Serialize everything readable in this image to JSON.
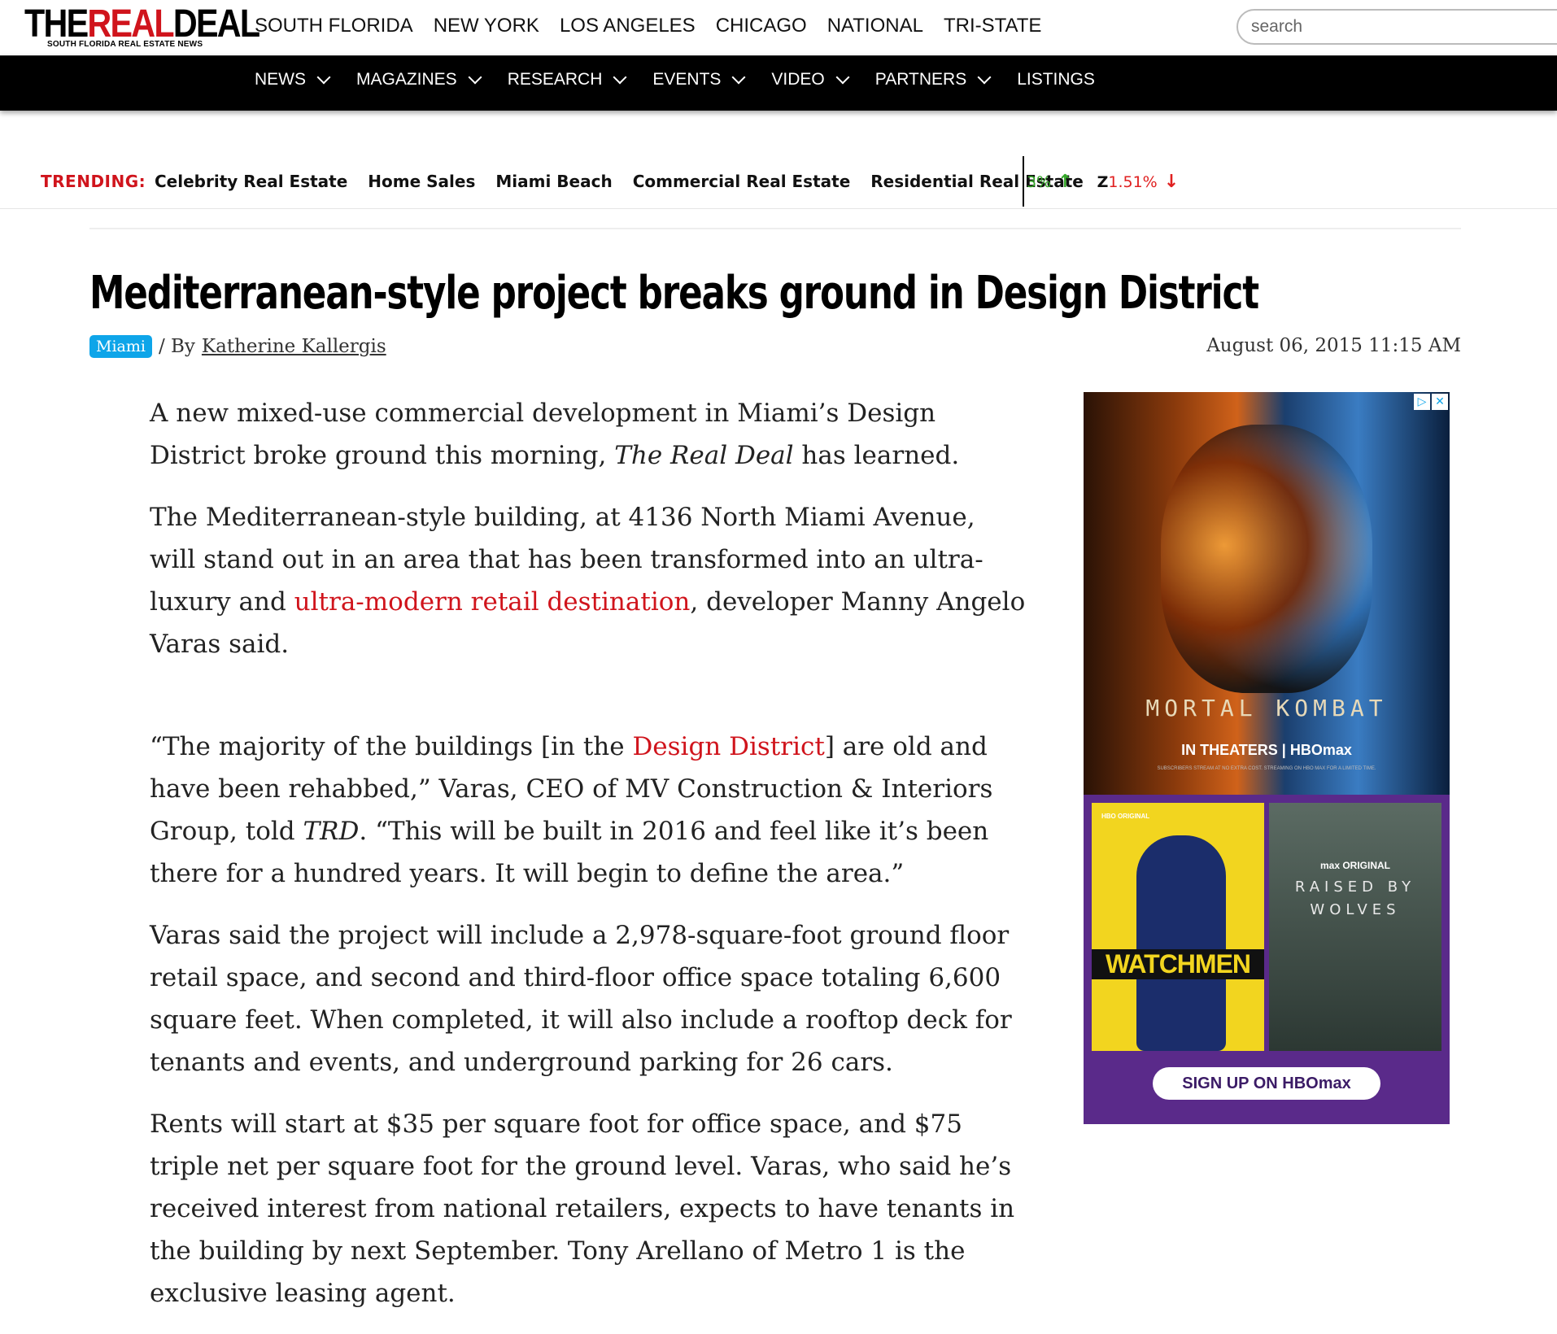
{
  "header": {
    "logo_main_the": "THE",
    "logo_main_real": "REAL",
    "logo_main_deal": "DEAL",
    "logo_sub": "SOUTH FLORIDA REAL ESTATE NEWS",
    "regions": [
      "SOUTH FLORIDA",
      "NEW YORK",
      "LOS ANGELES",
      "CHICAGO",
      "NATIONAL",
      "TRI-STATE"
    ],
    "search_placeholder": "search"
  },
  "menu": {
    "items": [
      {
        "label": "NEWS",
        "icon": "chevron-down-icon"
      },
      {
        "label": "MAGAZINES",
        "icon": "chevron-down-icon"
      },
      {
        "label": "RESEARCH",
        "icon": "chevron-down-icon"
      },
      {
        "label": "EVENTS",
        "icon": "chevron-down-icon"
      },
      {
        "label": "VIDEO",
        "icon": "chevron-down-icon"
      },
      {
        "label": "PARTNERS",
        "icon": "chevron-down-icon"
      },
      {
        "label": "LISTINGS"
      }
    ]
  },
  "trending": {
    "label": "TRENDING:",
    "links": [
      "Celebrity Real Estate",
      "Home Sales",
      "Miami Beach",
      "Commercial Real Estate",
      "Residential Real Estate"
    ],
    "ticker": [
      {
        "symbol": "",
        "change": "3%",
        "direction": "up",
        "color": "#35a829"
      },
      {
        "symbol": "Z",
        "change": "1.51%",
        "direction": "down",
        "color": "#e02020"
      }
    ]
  },
  "article": {
    "headline": "Mediterranean-style project breaks ground in Design District",
    "tag": "Miami",
    "by_prefix": "/ By",
    "author": "Katherine Kallergis",
    "date": "August 06, 2015 11:15 AM",
    "p1_a": "A new mixed-use commercial development in Miami’s Design District broke ground this morning, ",
    "p1_em": "The Real Deal",
    "p1_b": " has learned.",
    "p2_a": "The Mediterranean-style building, at 4136 North Miami Avenue, will stand out in an area that has been transformed into an ultra-luxury and ",
    "p2_link": "ultra-modern retail destination",
    "p2_b": ", developer Manny Angelo Varas said.",
    "p3_a": "“The majority of the buildings [in the ",
    "p3_link": "Design District",
    "p3_b": "] are old and have been rehabbed,” Varas, CEO of MV Construction & Interiors Group, told ",
    "p3_em": "TRD",
    "p3_c": ". “This will be built in 2016 and feel like it’s been there for a hundred years. It will begin to define the area.”",
    "p4": "Varas said the project will include a 2,978-square-foot ground floor retail space, and second and third-floor office space totaling 6,600 square feet. When completed, it will also include a rooftop deck for tenants and events, and underground parking for 26 cars.",
    "p5": "Rents will start at $35 per square foot for office space, and $75 triple net per square foot for the ground level. Varas, who said he’s received interest from national retailers, expects to have tenants in the building by next September. Tony Arellano of Metro 1 is the exclusive leasing agent."
  },
  "ad": {
    "title": "MORTAL KOMBAT",
    "subtitle": "IN THEATERS | HBOmax",
    "fine_print": "SUBSCRIBERS STREAM AT NO EXTRA COST. STREAMING ON HBO MAX FOR A LIMITED TIME.",
    "hbo_badge": "HBO ORIGINAL",
    "left_show": "WATCHMEN",
    "right_label": "max ORIGINAL",
    "right_show": "RAISED BY WOLVES",
    "cta": "SIGN UP ON HBOmax",
    "badge_info": "▷",
    "badge_close": "✕"
  },
  "colors": {
    "accent_red": "#d0141c",
    "tag_blue": "#0ea5e9",
    "menu_bg": "#000000"
  }
}
